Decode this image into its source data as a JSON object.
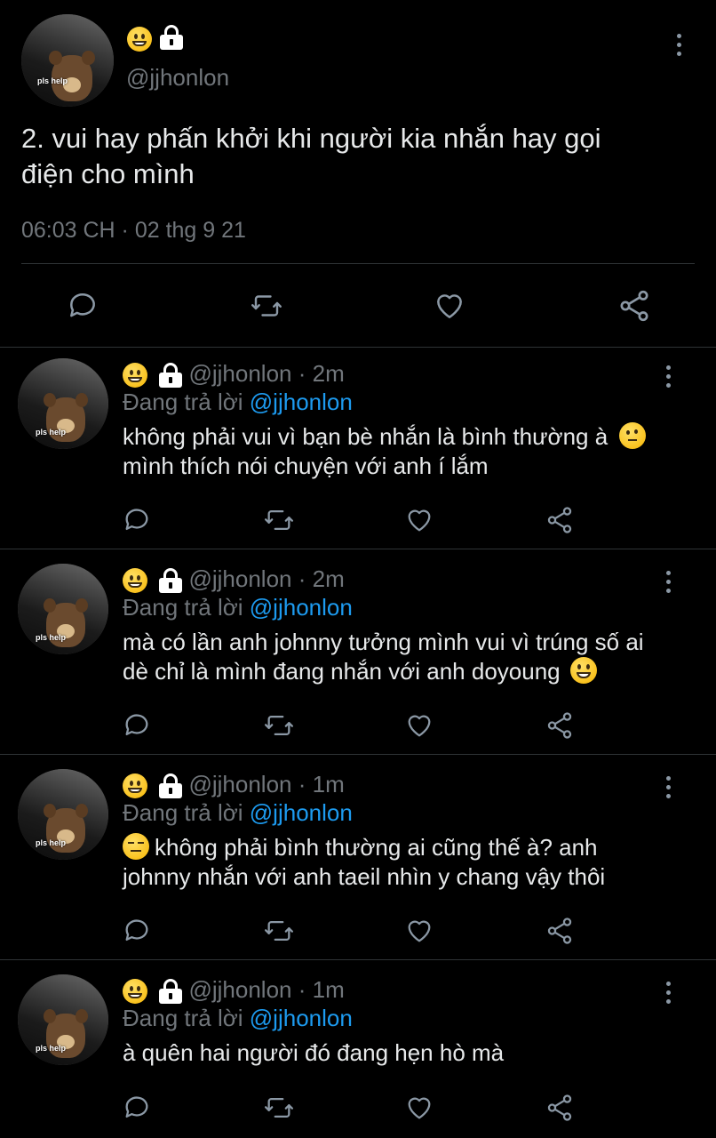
{
  "main_tweet": {
    "avatar_tag": "pls help",
    "handle": "@jjhonlon",
    "text_line1": "2. vui hay phấn khởi khi người kia nhắn hay gọi",
    "text_line2": "điện cho mình",
    "timestamp": "06:03 CH · 02 thg 9 21"
  },
  "replies": [
    {
      "avatar_tag": "pls help",
      "handle": "@jjhonlon",
      "time": "· 2m",
      "reply_prefix": "Đang trả lời ",
      "reply_to": "@jjhonlon",
      "line1": "không phải vui vì bạn bè nhắn là bình thường à",
      "line1_emoji": "thinking-emoji",
      "line2": "mình thích nói chuyện với anh í lắm"
    },
    {
      "avatar_tag": "pls help",
      "handle": "@jjhonlon",
      "time": "· 2m",
      "reply_prefix": "Đang trả lời ",
      "reply_to": "@jjhonlon",
      "line1": "mà có lần anh johnny tưởng mình vui vì trúng số ai",
      "line2": "dè chỉ là mình đang nhắn với anh doyoung",
      "line2_emoji": "grinning-emoji"
    },
    {
      "avatar_tag": "pls help",
      "handle": "@jjhonlon",
      "time": "· 1m",
      "reply_prefix": "Đang trả lời ",
      "reply_to": "@jjhonlon",
      "line1_emoji": "expressionless-emoji",
      "line1": "không phải bình thường ai cũng thế à? anh",
      "line2": "johnny nhắn với anh taeil nhìn y chang vậy thôi"
    },
    {
      "avatar_tag": "pls help",
      "handle": "@jjhonlon",
      "time": "· 1m",
      "reply_prefix": "Đang trả lời ",
      "reply_to": "@jjhonlon",
      "line1": "à quên hai người đó đang hẹn hò mà"
    }
  ],
  "icons": [
    "reply-icon",
    "retweet-icon",
    "like-icon",
    "share-icon",
    "more-icon",
    "lock-icon",
    "grinning-emoji"
  ],
  "colors": {
    "background": "#000000",
    "text": "#e7e9ea",
    "muted": "#71767b",
    "link": "#1d9bf0",
    "divider": "#2f3336"
  }
}
